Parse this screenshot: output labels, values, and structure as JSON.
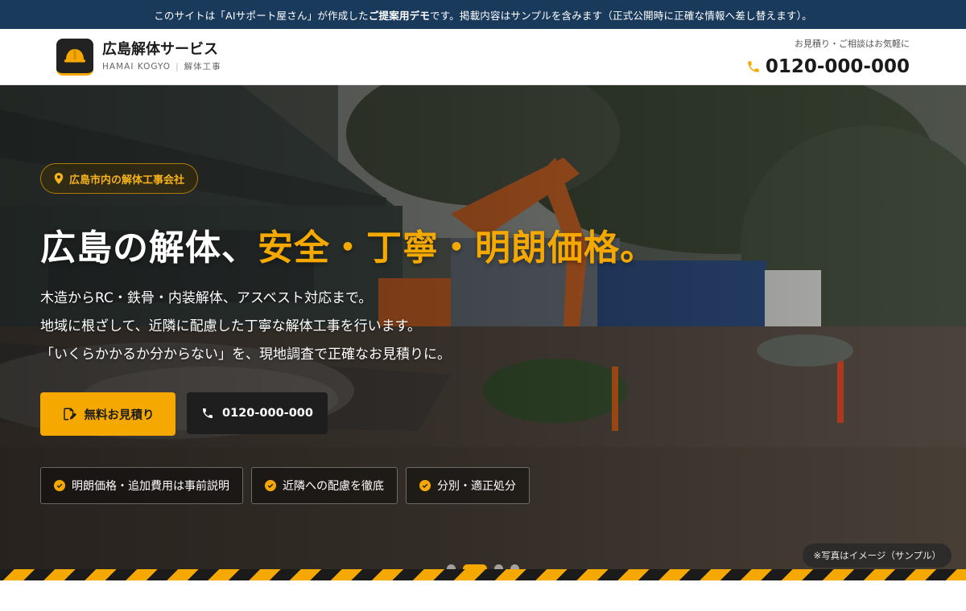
{
  "notice": {
    "prefix": "このサイトは「AIサポート屋さん」が作成した",
    "bold": "ご提案用デモ",
    "suffix": "です。掲載内容はサンプルを含みます（正式公開時に正確な情報へ差し替えます）。"
  },
  "header": {
    "logo_icon": "helmet-icon",
    "brand_name": "広島解体サービス",
    "brand_roman": "HAMAI KOGYO",
    "brand_category": "解体工事",
    "contact_lead": "お見積り・ご相談はお気軽に",
    "phone_icon": "phone-icon",
    "phone": "0120-000-000"
  },
  "hero": {
    "badge": "広島市内の解体工事会社",
    "badge_icon": "map-pin-icon",
    "headline_plain": "広島の解体、",
    "headline_accent": "安全・丁寧・明朗価格。",
    "desc": [
      "木造からRC・鉄骨・内装解体、アスベスト対応まで。",
      "地域に根ざして、近隣に配慮した丁寧な解体工事を行います。",
      "「いくらかかるか分からない」を、現地調査で正確なお見積りに。"
    ],
    "cta_primary": "無料お見積り",
    "cta_primary_icon": "document-edit-icon",
    "cta_phone": "0120-000-000",
    "cta_phone_icon": "phone-icon",
    "features": [
      "明朗価格・追加費用は事前説明",
      "近隣への配慮を徹底",
      "分別・適正処分"
    ],
    "photo_caption": "※写真はイメージ（サンプル）",
    "slider": {
      "total": 4,
      "active": 2
    }
  },
  "colors": {
    "accent": "#f5a800",
    "notice_bg": "#1a3a5c",
    "dark": "#1e1e1e"
  }
}
